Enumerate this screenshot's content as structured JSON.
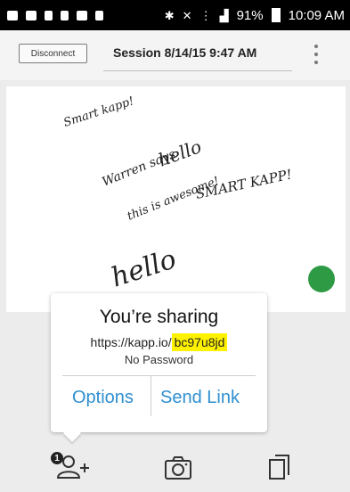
{
  "status_bar": {
    "battery": "91%",
    "time": "10:09 AM"
  },
  "header": {
    "disconnect_label": "Disconnect",
    "session_title": "Session 8/14/15 9:47 AM"
  },
  "canvas": {
    "notes": [
      "Smart kapp!",
      "Warren says",
      "hello",
      "this is awesome!",
      "SMART KAPP!",
      "hello"
    ]
  },
  "share_popup": {
    "title": "You’re sharing",
    "url_prefix": "https://kapp.io/",
    "url_code": "bc97u8jd",
    "password_text": "No Password",
    "options_label": "Options",
    "send_link_label": "Send Link"
  },
  "toolbar": {
    "participants_badge": "1"
  },
  "colors": {
    "accent_blue": "#2f8fd0",
    "status_green": "#2e9a44",
    "highlight_yellow": "#fff200"
  },
  "icons": [
    "menu-kebab-icon",
    "add-person-icon",
    "camera-icon",
    "copy-pages-icon"
  ]
}
